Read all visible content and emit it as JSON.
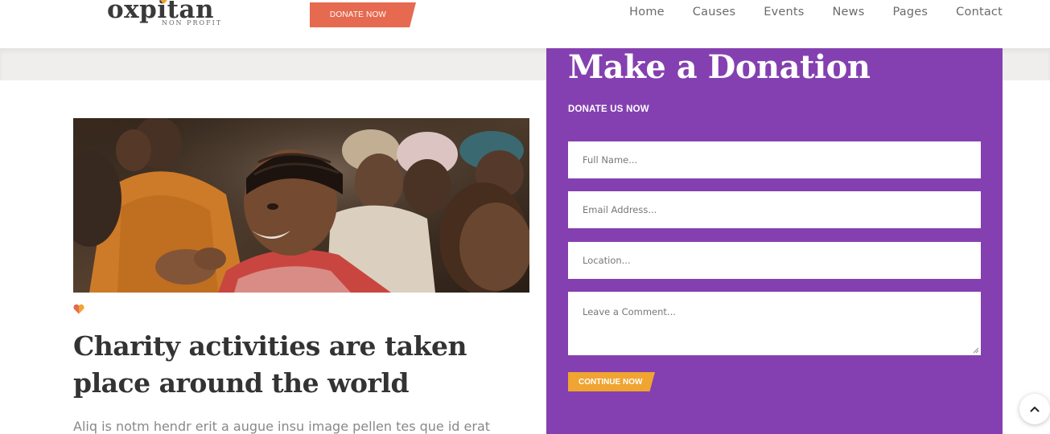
{
  "header": {
    "logo_text": "oxpitan",
    "logo_subtext": "NON PROFIT",
    "donate_button": "DONATE NOW",
    "nav": [
      "Home",
      "Causes",
      "Events",
      "News",
      "Pages",
      "Contact"
    ]
  },
  "article": {
    "headline": "Charity activities are taken place around the world",
    "excerpt": "Aliq is notm hendr erit a augue insu image pellen tes que id erat"
  },
  "donation": {
    "title": "Make a Donation",
    "subtitle": "DONATE US NOW",
    "fields": {
      "full_name_placeholder": "Full Name...",
      "email_placeholder": "Email Address...",
      "location_placeholder": "Location...",
      "comment_placeholder": "Leave a Comment..."
    },
    "continue_button": "CONTINUE NOW"
  },
  "icons": {
    "heart": "heart-icon",
    "scroll_top": "chevron-up-icon"
  },
  "colors": {
    "accent_orange": "#f0a431",
    "donate_red": "#e66a50",
    "panel_purple": "#8440b0"
  }
}
